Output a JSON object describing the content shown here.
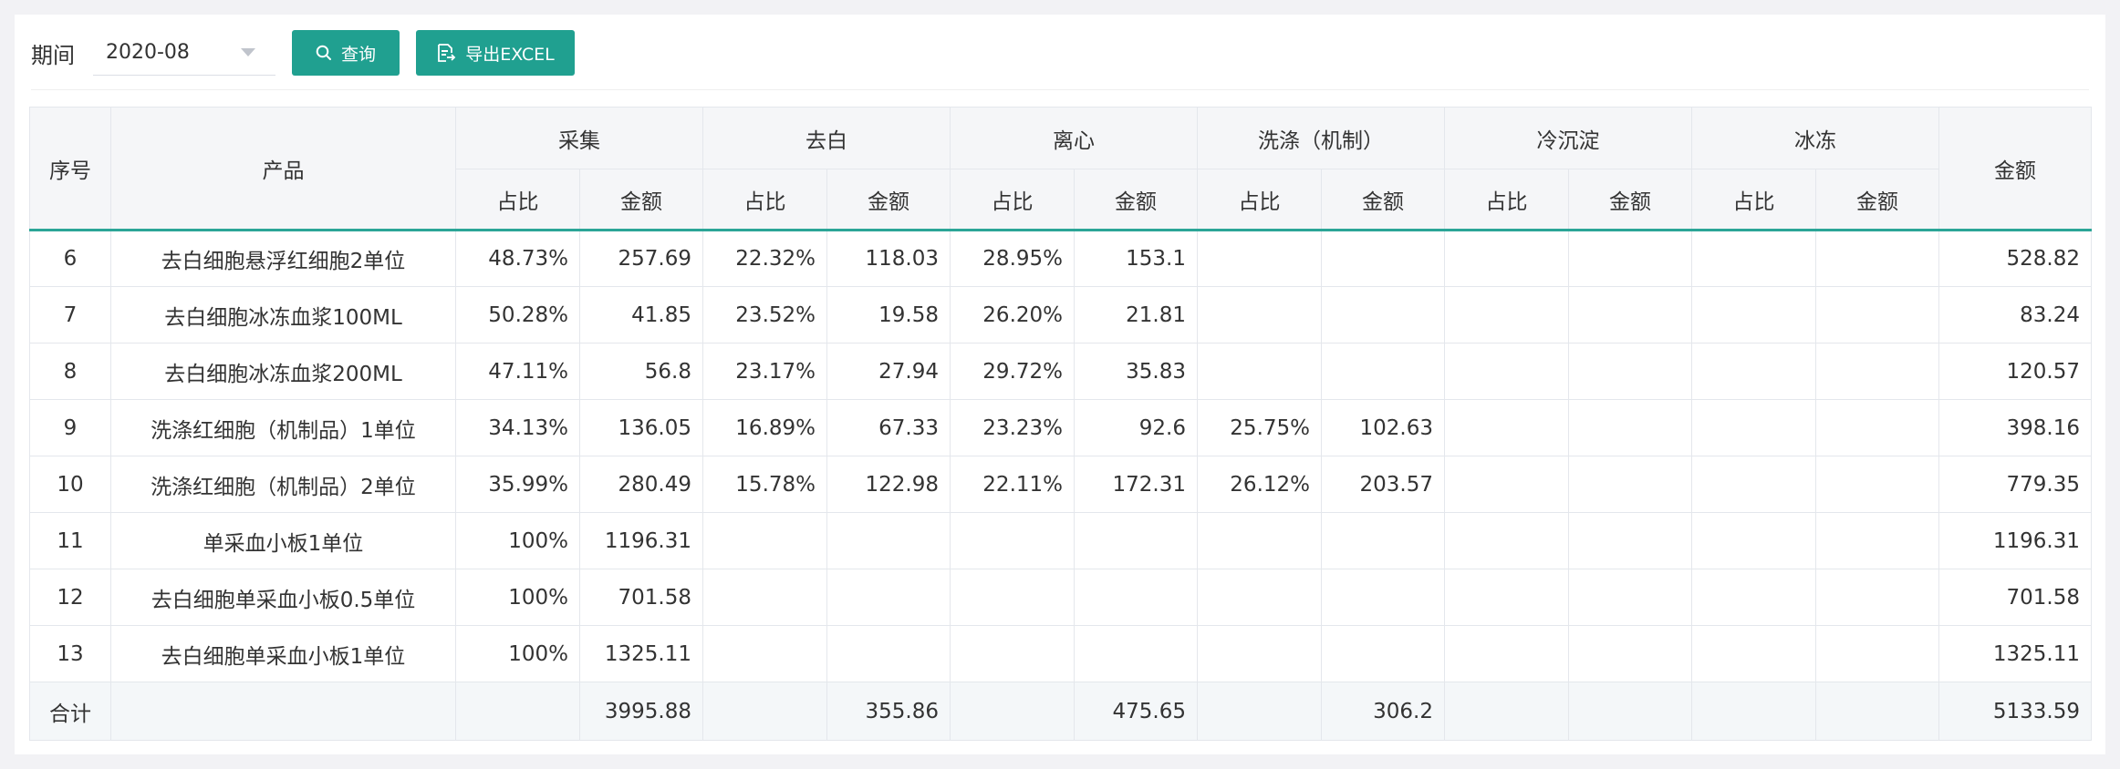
{
  "filter": {
    "period_label": "期间",
    "period_value": "2020-08"
  },
  "buttons": {
    "search_label": "查询",
    "export_label": "导出EXCEL"
  },
  "icons": {
    "search": "search-icon",
    "export": "excel-export-icon",
    "dropdown": "chevron-down-icon"
  },
  "colors": {
    "accent": "#20a090",
    "header_bg": "#f5f6f8",
    "total_bg": "#f4f7f9",
    "border": "#e4e7ec"
  },
  "table": {
    "headers": {
      "seq": "序号",
      "product": "产品",
      "groups": [
        "采集",
        "去白",
        "离心",
        "洗涤（机制）",
        "冷沉淀",
        "冰冻"
      ],
      "ratio": "占比",
      "amount": "金额",
      "total_amount": "金额"
    },
    "rows": [
      {
        "seq": "6",
        "product": "去白细胞悬浮红细胞2单位",
        "cells": [
          "48.73%",
          "257.69",
          "22.32%",
          "118.03",
          "28.95%",
          "153.1",
          "",
          "",
          "",
          "",
          "",
          ""
        ],
        "total": "528.82"
      },
      {
        "seq": "7",
        "product": "去白细胞冰冻血浆100ML",
        "cells": [
          "50.28%",
          "41.85",
          "23.52%",
          "19.58",
          "26.20%",
          "21.81",
          "",
          "",
          "",
          "",
          "",
          ""
        ],
        "total": "83.24"
      },
      {
        "seq": "8",
        "product": "去白细胞冰冻血浆200ML",
        "cells": [
          "47.11%",
          "56.8",
          "23.17%",
          "27.94",
          "29.72%",
          "35.83",
          "",
          "",
          "",
          "",
          "",
          ""
        ],
        "total": "120.57"
      },
      {
        "seq": "9",
        "product": "洗涤红细胞（机制品）1单位",
        "cells": [
          "34.13%",
          "136.05",
          "16.89%",
          "67.33",
          "23.23%",
          "92.6",
          "25.75%",
          "102.63",
          "",
          "",
          "",
          ""
        ],
        "total": "398.16"
      },
      {
        "seq": "10",
        "product": "洗涤红细胞（机制品）2单位",
        "cells": [
          "35.99%",
          "280.49",
          "15.78%",
          "122.98",
          "22.11%",
          "172.31",
          "26.12%",
          "203.57",
          "",
          "",
          "",
          ""
        ],
        "total": "779.35"
      },
      {
        "seq": "11",
        "product": "单采血小板1单位",
        "cells": [
          "100%",
          "1196.31",
          "",
          "",
          "",
          "",
          "",
          "",
          "",
          "",
          "",
          ""
        ],
        "total": "1196.31"
      },
      {
        "seq": "12",
        "product": "去白细胞单采血小板0.5单位",
        "cells": [
          "100%",
          "701.58",
          "",
          "",
          "",
          "",
          "",
          "",
          "",
          "",
          "",
          ""
        ],
        "total": "701.58"
      },
      {
        "seq": "13",
        "product": "去白细胞单采血小板1单位",
        "cells": [
          "100%",
          "1325.11",
          "",
          "",
          "",
          "",
          "",
          "",
          "",
          "",
          "",
          ""
        ],
        "total": "1325.11"
      }
    ],
    "total_row": {
      "label": "合计",
      "product": "",
      "cells": [
        "",
        "3995.88",
        "",
        "355.86",
        "",
        "475.65",
        "",
        "306.2",
        "",
        "",
        "",
        ""
      ],
      "total": "5133.59"
    }
  }
}
